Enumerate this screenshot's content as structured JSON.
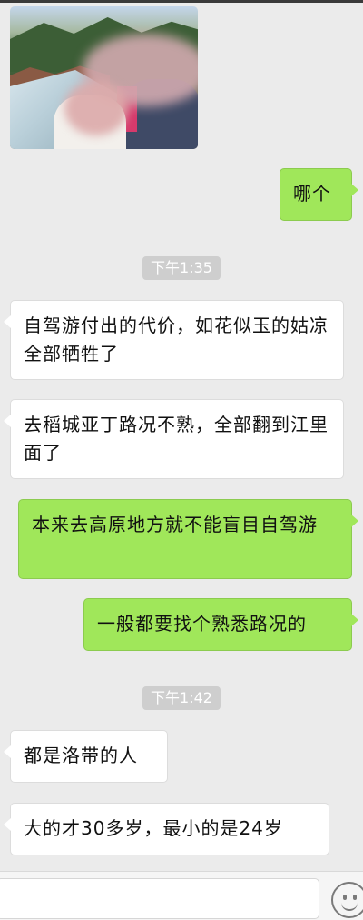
{
  "messages": {
    "m1": "哪个",
    "t1": "下午1:35",
    "m2": "自驾游付出的代价，如花似玉的姑凉全部牺牲了",
    "m3": "去稻城亚丁路况不熟，全部翻到江里面了",
    "m4": "本来去高原地方就不能盲目自驾游",
    "m5": "一般都要找个熟悉路况的",
    "t2": "下午1:42",
    "m6": "都是洛带的人",
    "m7": "大的才30多岁，最小的是24岁"
  },
  "icons": {
    "emoji": "smiley-face-icon"
  },
  "colors": {
    "background": "#ebebeb",
    "sent_bubble": "#a0e75a",
    "received_bubble": "#ffffff",
    "timestamp_bg": "#cecece"
  }
}
